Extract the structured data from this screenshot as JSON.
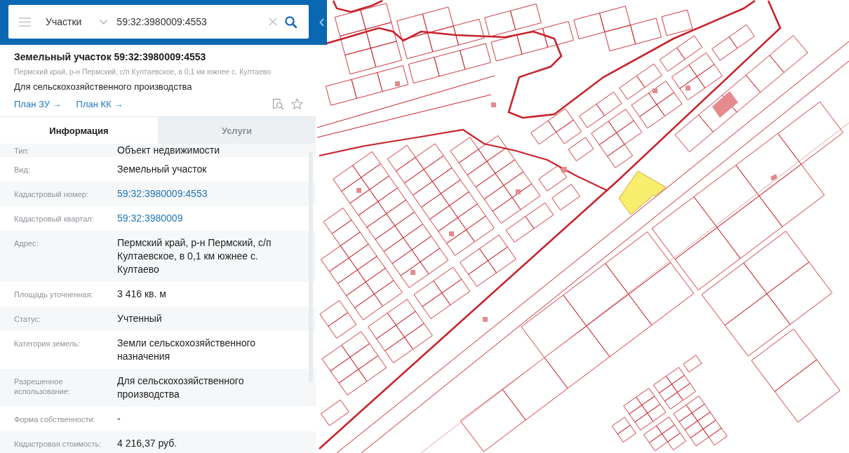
{
  "search_bar": {
    "category": "Участки",
    "query": "59:32:3980009:4553"
  },
  "parcel": {
    "title": "Земельный участок 59:32:3980009:4553",
    "address": "Пермский край, р-н Пермский, с/п Култаевское, в 0,1 км южнее с. Култаево",
    "purpose": "Для сельскохозяйственного производства",
    "links": [
      "План ЗУ →",
      "План КК →"
    ],
    "favorite": false
  },
  "tabs": [
    {
      "label": "Информация",
      "selected": true
    },
    {
      "label": "Услуги",
      "selected": false
    }
  ],
  "properties": [
    {
      "label": "Тип:",
      "value": "Объект недвижимости",
      "kind": "text"
    },
    {
      "label": "Вид:",
      "value": "Земельный участок",
      "kind": "text"
    },
    {
      "label": "Кадастровый номер:",
      "value": "59:32:3980009:4553",
      "kind": "link"
    },
    {
      "label": "Кадастровый квартал:",
      "value": "59:32:3980009",
      "kind": "link"
    },
    {
      "label": "Адрес:",
      "value": "Пермский край, р-н Пермский, с/п Култаевское, в 0,1 км южнее с. Култаево",
      "kind": "text"
    },
    {
      "label": "Площадь уточненная:",
      "value": "3 416 кв. м",
      "kind": "text"
    },
    {
      "label": "Статус:",
      "value": "Учтенный",
      "kind": "text"
    },
    {
      "label": "Категория земель:",
      "value": "Земли сельскохозяйственного назначения",
      "kind": "text"
    },
    {
      "label": "Разрешенное использование:",
      "value": "Для сельскохозяйственного производства",
      "kind": "text"
    },
    {
      "label": "Форма собственности:",
      "value": "-",
      "kind": "text"
    },
    {
      "label": "Кадастровая стоимость:",
      "value": "4 216,37 руб.",
      "kind": "text"
    }
  ]
}
